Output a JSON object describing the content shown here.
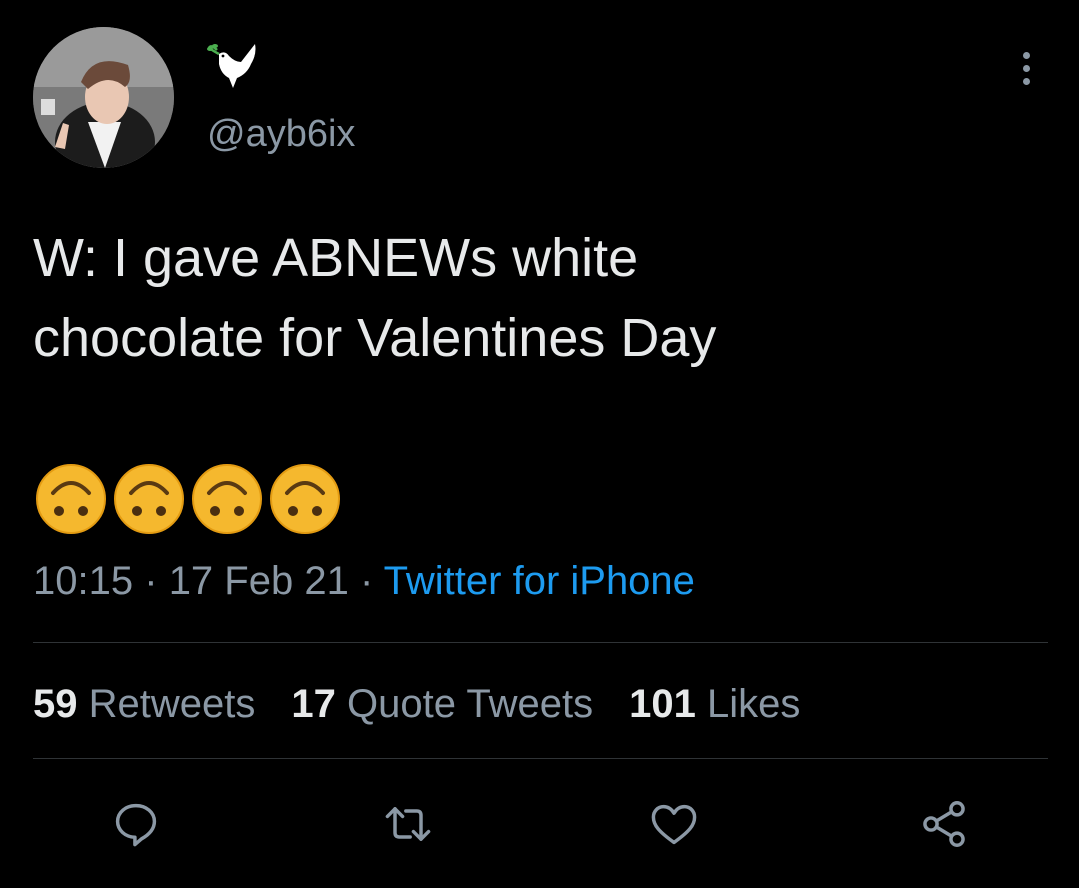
{
  "tweet": {
    "handle": "@ayb6ix",
    "display_name_icon": "dove-with-olive-branch-icon",
    "text": "W: I gave ABNEWs white\nchocolate for Valentines Day",
    "emoji_icon": "upside-down-face-icon",
    "emoji_count": 4,
    "time": "10:15",
    "date": "17 Feb 21",
    "separator": "·",
    "source": "Twitter for iPhone"
  },
  "stats": {
    "retweets": {
      "count": "59",
      "label": "Retweets"
    },
    "quotes": {
      "count": "17",
      "label": "Quote Tweets"
    },
    "likes": {
      "count": "101",
      "label": "Likes"
    }
  },
  "actions": [
    "reply-icon",
    "retweet-icon",
    "like-icon",
    "share-icon"
  ],
  "colors": {
    "background": "#000000",
    "text": "#e7e9ea",
    "secondary": "#8b98a5",
    "link": "#1d9bf0",
    "divider": "#2f3336"
  }
}
